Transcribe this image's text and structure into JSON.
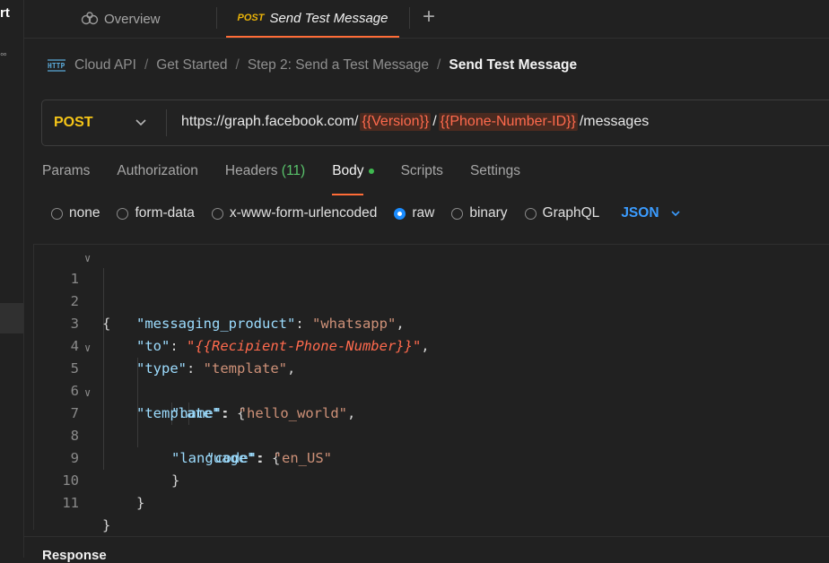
{
  "left_fragment": {
    "text": "rt",
    "dots": "°°"
  },
  "tabs": {
    "overview": "Overview",
    "active_method": "POST",
    "active_title": "Send Test Message",
    "add": "+"
  },
  "breadcrumb": {
    "items": [
      "Cloud API",
      "Get Started",
      "Step 2: Send a Test Message"
    ],
    "current": "Send Test Message",
    "sep": "/"
  },
  "request": {
    "method": "POST",
    "url_prefix": "https://graph.facebook.com/",
    "var1": "{{Version}}",
    "slash": "/",
    "var2": "{{Phone-Number-ID}}",
    "url_suffix": "/messages"
  },
  "request_tabs": {
    "params": "Params",
    "authorization": "Authorization",
    "headers": "Headers",
    "headers_count": "(11)",
    "body": "Body",
    "scripts": "Scripts",
    "settings": "Settings"
  },
  "body_types": {
    "none": "none",
    "form_data": "form-data",
    "urlencoded": "x-www-form-urlencoded",
    "raw": "raw",
    "binary": "binary",
    "graphql": "GraphQL",
    "language": "JSON",
    "selected": "raw"
  },
  "code": {
    "line_numbers": [
      "1",
      "2",
      "3",
      "4",
      "5",
      "6",
      "7",
      "8",
      "9",
      "10",
      "11"
    ],
    "l1": "{",
    "l2_key": "\"messaging_product\"",
    "l2_val": "\"whatsapp\"",
    "l3_key": "\"to\"",
    "l3_val": "\"{{Recipient-Phone-Number}}\"",
    "l4_key": "\"type\"",
    "l4_val": "\"template\"",
    "l5_key": "\"template\"",
    "l5_open": "{",
    "l6_key": "\"name\"",
    "l6_val": "\"hello_world\"",
    "l7_key": "\"language\"",
    "l7_open": "{",
    "l8_key": "\"code\"",
    "l8_val": "\"en_US\"",
    "l9": "}",
    "l10": "}",
    "l11": "}"
  },
  "response": {
    "label": "Response"
  },
  "colors": {
    "accent": "#ff6c37",
    "method": "#f5c518",
    "link": "#3b9cff",
    "variable": "#ff6a4d"
  }
}
